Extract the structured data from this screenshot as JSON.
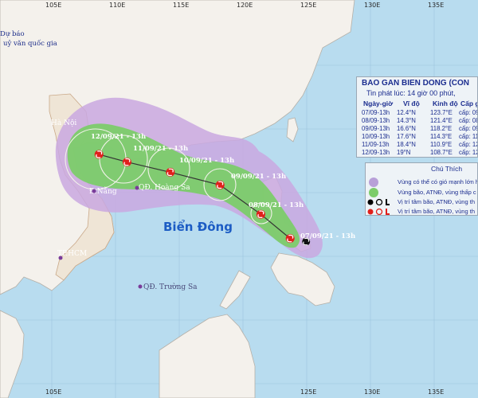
{
  "bulletin": {
    "title": "BAO GAN BIEN DONG (CON",
    "issued": "Tin phát lúc: 14 giờ 00 phút,",
    "headers": [
      "Ngày-giờ",
      "Vĩ độ",
      "Kinh độ",
      "Cấp gió"
    ],
    "rows": [
      [
        "07/09-13h",
        "12.4°N",
        "123.7°E",
        "cấp: 09"
      ],
      [
        "08/09-13h",
        "14.3°N",
        "121.4°E",
        "cấp: 08"
      ],
      [
        "09/09-13h",
        "16.6°N",
        "118.2°E",
        "cấp: 09"
      ],
      [
        "10/09-13h",
        "17.6°N",
        "114.3°E",
        "cấp: 11"
      ],
      [
        "11/09-13h",
        "18.4°N",
        "110.9°E",
        "cấp: 12"
      ],
      [
        "12/09-13h",
        "19°N",
        "108.7°E",
        "cấp: 12"
      ]
    ]
  },
  "legend": {
    "title": "Chú Thích",
    "items": [
      {
        "text": "Vùng có thể có gió mạnh lớn hơ",
        "color": "#b8a0d8"
      },
      {
        "text": "Vùng bão, ATNĐ, vùng thấp c",
        "color": "#7ccc6a"
      },
      {
        "text": "Vị trí tâm bão, ATNĐ, vùng th",
        "color": "#000000"
      },
      {
        "text": "Vị trí tâm bão, ATNĐ, vùng th",
        "color": "#e0201c"
      }
    ],
    "symbols_black": "S O L",
    "symbols_red": "S O L"
  },
  "map": {
    "sea_label": "Biển Đông",
    "agency_line1": "Dự báo",
    "agency_line2": "uỷ văn quốc gia",
    "places": [
      "Hà Nội",
      "Đ.Nẵng",
      "TP.HCM",
      "QĐ. Hoàng Sa",
      "QĐ. Trường Sa"
    ],
    "lon_ticks": [
      "105E",
      "110E",
      "115E",
      "120E",
      "125E",
      "130E",
      "135E"
    ],
    "track_points": [
      {
        "label": "07/09/21 - 13h",
        "lon": 123.7,
        "lat": 12.4,
        "wind": 9
      },
      {
        "label": "08/09/21 - 13h",
        "lon": 121.4,
        "lat": 14.3,
        "wind": 8
      },
      {
        "label": "09/09/21 - 13h",
        "lon": 118.2,
        "lat": 16.6,
        "wind": 9
      },
      {
        "label": "10/09/21 - 13h",
        "lon": 114.3,
        "lat": 17.6,
        "wind": 11
      },
      {
        "label": "11/09/21 - 13h",
        "lon": 110.9,
        "lat": 18.4,
        "wind": 12
      },
      {
        "label": "12/09/21 - 13h",
        "lon": 108.7,
        "lat": 19.0,
        "wind": 12
      }
    ],
    "colors": {
      "sea": "#b8dcef",
      "land": "#f4f1ec",
      "wind_zone": "#c9a8e0",
      "storm_zone": "#7ccc6a",
      "track": "#333333",
      "storm_center": "#e0201c"
    }
  }
}
